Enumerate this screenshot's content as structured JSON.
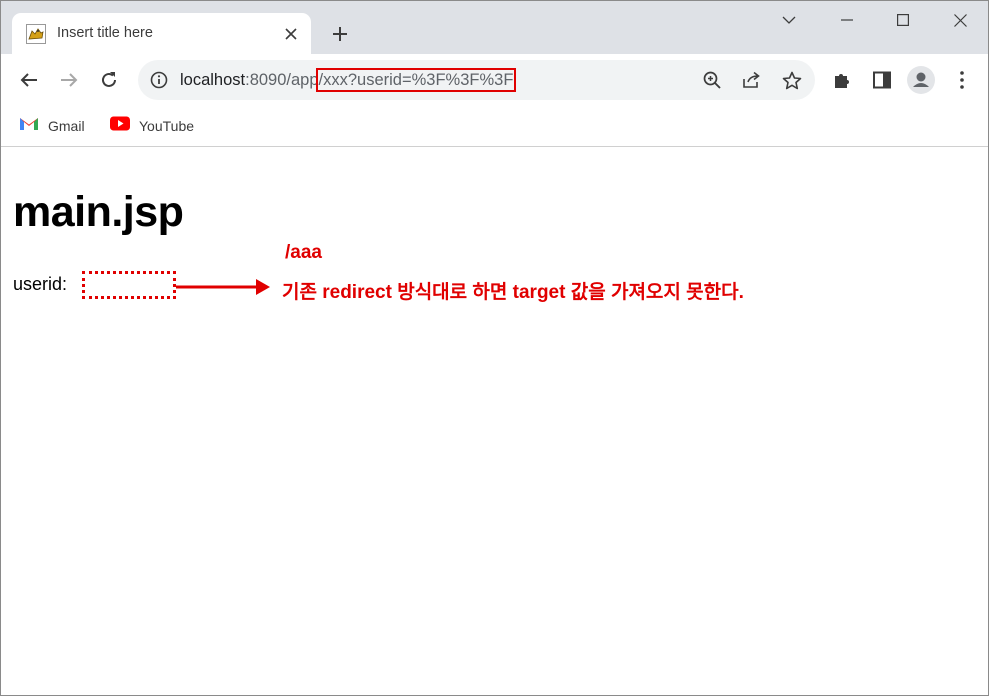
{
  "browser": {
    "tab": {
      "title": "Insert title here",
      "favicon": "tomcat-favicon-icon"
    },
    "window_controls": [
      "chevron-down-icon",
      "minimize-icon",
      "maximize-icon",
      "close-icon"
    ],
    "address_bar": {
      "url_host": "localhost",
      "url_port_path": ":8090/app",
      "url_highlighted": "/xxx?userid=%3F%3F%3F",
      "highlight_color": "#e00000"
    },
    "bookmarks": [
      {
        "label": "Gmail",
        "icon": "gmail-icon"
      },
      {
        "label": "YouTube",
        "icon": "youtube-icon"
      }
    ]
  },
  "page": {
    "heading": "main.jsp",
    "userid_label": "userid:",
    "annotation_path": "/aaa",
    "annotation_message": "기존 redirect 방식대로 하면 target 값을 가져오지 못한다.",
    "annotation_color": "#e00000"
  }
}
